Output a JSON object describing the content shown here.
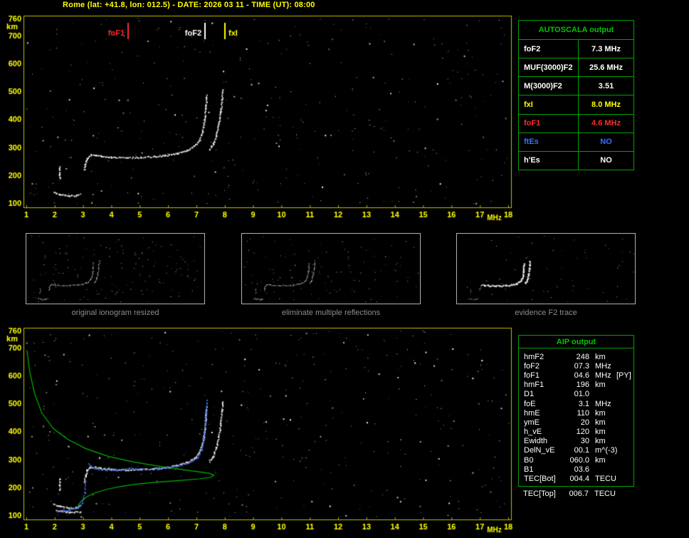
{
  "palette": {
    "yellow": "#ffff00",
    "axis": "#bcbc00",
    "red": "#ff2a2a",
    "blue": "#3a6eff",
    "white": "#ffffff",
    "green": "#00c400",
    "green_border": "#00a000",
    "green_line": "#00b400",
    "blue_trace": "#4a7cff",
    "gray": "#8c8c8c",
    "bg": "#000000"
  },
  "header": {
    "title": "Rome (lat: +41.8, lon: 012.5) - DATE: 2026 03 11 - TIME (UT): 08:00"
  },
  "autoscala": {
    "title": "AUTOSCALA output",
    "rows": [
      {
        "label": "foF2",
        "value": "7.3 MHz",
        "color": "white"
      },
      {
        "label": "MUF(3000)F2",
        "value": "25.6 MHz",
        "color": "white"
      },
      {
        "label": "M(3000)F2",
        "value": "3.51",
        "color": "white"
      },
      {
        "label": "fxI",
        "value": "8.0 MHz",
        "color": "yellow"
      },
      {
        "label": "foF1",
        "value": "4.6 MHz",
        "color": "red"
      },
      {
        "label": "ftEs",
        "value": "NO",
        "color": "blue"
      },
      {
        "label": "h'Es",
        "value": "NO",
        "color": "white"
      }
    ]
  },
  "thumbnails": [
    {
      "caption": "original ionogram resized"
    },
    {
      "caption": "eliminate multiple reflections"
    },
    {
      "caption": "evidence F2 trace"
    }
  ],
  "aip": {
    "title": "AIP output",
    "rows": [
      {
        "label": "hmF2",
        "value": "248",
        "unit": "km"
      },
      {
        "label": "foF2",
        "value": "07.3",
        "unit": "MHz"
      },
      {
        "label": "foF1",
        "value": "04.6",
        "unit": "MHz",
        "note": "[PY]"
      },
      {
        "label": "hmF1",
        "value": "196",
        "unit": "km"
      },
      {
        "label": "D1",
        "value": "01.0",
        "unit": ""
      },
      {
        "label": "foE",
        "value": "3.1",
        "unit": "MHz"
      },
      {
        "label": "hmE",
        "value": "110",
        "unit": "km"
      },
      {
        "label": "ymE",
        "value": "20",
        "unit": "km"
      },
      {
        "label": "h_vE",
        "value": "120",
        "unit": "km"
      },
      {
        "label": "Ewidth",
        "value": "30",
        "unit": "km"
      },
      {
        "label": "DelN_vE",
        "value": "00.1",
        "unit": "m^(-3)"
      },
      {
        "label": "B0",
        "value": "060.0",
        "unit": "km"
      },
      {
        "label": "B1",
        "value": "03.6",
        "unit": ""
      }
    ],
    "tec_rows": [
      {
        "label": "TEC[Bot]",
        "value": "004.4",
        "unit": "TECU"
      },
      {
        "label": "TEC[Top]",
        "value": "006.7",
        "unit": "TECU"
      }
    ]
  },
  "chart_data": [
    {
      "id": "main-ionogram",
      "type": "scatter",
      "xlabel": "MHz",
      "ylabel": "km",
      "xlim": [
        1,
        18
      ],
      "ylim": [
        100,
        760
      ],
      "xticks": [
        1,
        2,
        3,
        4,
        5,
        6,
        7,
        8,
        9,
        10,
        11,
        12,
        13,
        14,
        15,
        16,
        17,
        18
      ],
      "yticks": [
        760,
        700,
        600,
        500,
        400,
        300,
        200,
        100
      ],
      "markers": [
        {
          "label": "foF1",
          "freq": 4.6,
          "color": "red",
          "label_side": "left"
        },
        {
          "label": "foF2",
          "freq": 7.3,
          "color": "white",
          "label_side": "left"
        },
        {
          "label": "fxI",
          "freq": 8.0,
          "color": "yellow",
          "label_side": "right"
        }
      ],
      "noise_count": 380,
      "noise_seed": 11,
      "traces": {
        "es_layer": [
          [
            1.95,
            140
          ],
          [
            2.2,
            133
          ],
          [
            2.5,
            127
          ],
          [
            2.75,
            129
          ],
          [
            2.88,
            134
          ]
        ],
        "retardation_tick": [
          [
            2.16,
            232
          ],
          [
            2.16,
            190
          ]
        ],
        "ef_cusp": [
          [
            3.02,
            220
          ],
          [
            3.07,
            242
          ],
          [
            3.13,
            262
          ],
          [
            3.25,
            274
          ]
        ],
        "f_flat": [
          [
            3.25,
            274
          ],
          [
            3.6,
            270
          ],
          [
            4.0,
            266
          ],
          [
            4.5,
            264
          ],
          [
            5.0,
            265
          ],
          [
            5.5,
            268
          ],
          [
            5.9,
            272
          ]
        ],
        "f2_rise": [
          [
            5.9,
            272
          ],
          [
            6.3,
            280
          ],
          [
            6.65,
            290
          ],
          [
            6.9,
            304
          ],
          [
            7.08,
            324
          ],
          [
            7.2,
            356
          ],
          [
            7.27,
            398
          ],
          [
            7.31,
            442
          ],
          [
            7.34,
            488
          ]
        ],
        "x_mode": [
          [
            7.44,
            293
          ],
          [
            7.57,
            312
          ],
          [
            7.68,
            342
          ],
          [
            7.77,
            384
          ],
          [
            7.84,
            430
          ],
          [
            7.89,
            474
          ],
          [
            7.92,
            508
          ]
        ]
      }
    },
    {
      "id": "profile-ionogram",
      "type": "scatter",
      "xlabel": "MHz",
      "ylabel": "km",
      "xlim": [
        1,
        18
      ],
      "ylim": [
        100,
        760
      ],
      "xticks": [
        1,
        2,
        3,
        4,
        5,
        6,
        7,
        8,
        9,
        10,
        11,
        12,
        13,
        14,
        15,
        16,
        17,
        18
      ],
      "yticks": [
        760,
        700,
        600,
        500,
        400,
        300,
        200,
        100
      ],
      "noise_count": 400,
      "noise_seed": 23,
      "extra_traces": [
        [
          [
            2.05,
            118
          ],
          [
            2.5,
            112
          ],
          [
            2.9,
            114
          ]
        ]
      ],
      "profile_green": [
        [
          1.02,
          690
        ],
        [
          1.12,
          612
        ],
        [
          1.3,
          532
        ],
        [
          1.55,
          465
        ],
        [
          1.95,
          410
        ],
        [
          2.45,
          372
        ],
        [
          3.1,
          338
        ],
        [
          3.9,
          310
        ],
        [
          4.8,
          290
        ],
        [
          5.8,
          273
        ],
        [
          6.8,
          259
        ],
        [
          7.45,
          250
        ],
        [
          7.62,
          243
        ],
        [
          7.5,
          235
        ],
        [
          7.1,
          230
        ],
        [
          6.4,
          224
        ],
        [
          5.6,
          218
        ],
        [
          4.9,
          211
        ],
        [
          4.35,
          203
        ],
        [
          3.85,
          193
        ],
        [
          3.45,
          181
        ],
        [
          3.15,
          167
        ],
        [
          2.95,
          152
        ],
        [
          2.85,
          138
        ],
        [
          2.8,
          125
        ]
      ],
      "fitted_blue": [
        [
          [
            2.1,
            116
          ],
          [
            2.5,
            120
          ],
          [
            2.78,
            129
          ],
          [
            2.95,
            146
          ],
          [
            3.04,
            180
          ],
          [
            3.08,
            222
          ]
        ],
        [
          [
            3.17,
            286
          ],
          [
            3.32,
            271
          ],
          [
            3.65,
            264
          ],
          [
            4.05,
            262
          ],
          [
            4.45,
            265
          ],
          [
            4.62,
            271
          ],
          [
            4.85,
            267
          ],
          [
            5.25,
            266
          ],
          [
            5.65,
            268
          ],
          [
            6.05,
            273
          ],
          [
            6.45,
            281
          ],
          [
            6.8,
            293
          ],
          [
            7.02,
            308
          ],
          [
            7.16,
            334
          ],
          [
            7.25,
            376
          ],
          [
            7.3,
            424
          ],
          [
            7.33,
            470
          ],
          [
            7.35,
            512
          ]
        ]
      ]
    }
  ]
}
